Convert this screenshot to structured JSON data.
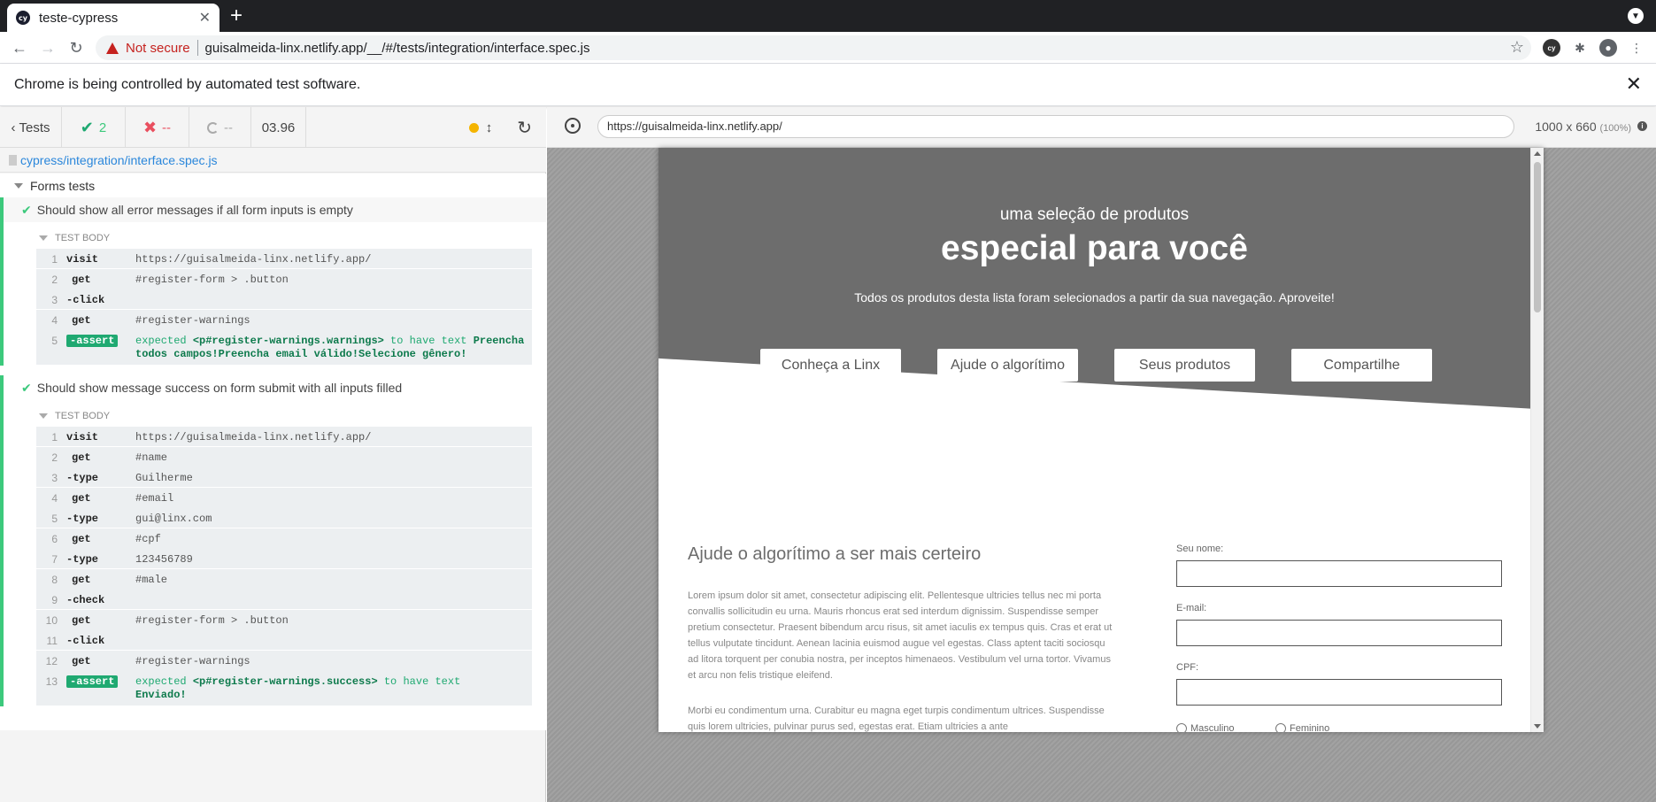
{
  "browser": {
    "tab_title": "teste-cypress",
    "tab_favicon": "cy",
    "new_tab": "+",
    "security": "Not secure",
    "url": "guisalmeida-linx.netlify.app/__/#/tests/integration/interface.spec.js",
    "infobar": "Chrome is being controlled by automated test software."
  },
  "reporter": {
    "tests_label": "Tests",
    "passed": "2",
    "failed": "--",
    "pending": "--",
    "duration": "03.96",
    "spec_path": "cypress/integration/interface.spec.js",
    "suite_title": "Forms tests",
    "tests": [
      {
        "title": "Should show all error messages if all form inputs is empty",
        "body_label": "TEST BODY",
        "commands": [
          {
            "num": "1",
            "name": "visit",
            "msg": "https://guisalmeida-linx.netlify.app/"
          },
          {
            "num": "2",
            "name": "get",
            "msg": "#register-form > .button"
          },
          {
            "num": "3",
            "name": "-click",
            "msg": ""
          },
          {
            "num": "4",
            "name": "get",
            "msg": "#register-warnings"
          },
          {
            "num": "5",
            "name": "-assert",
            "msg_prefix": "expected ",
            "msg_subject": "<p#register-warnings.warnings>",
            "msg_mid": " to have text ",
            "msg_value": "Preencha todos campos!Preencha email válido!Selecione gênero!"
          }
        ]
      },
      {
        "title": "Should show message success on form submit with all inputs filled",
        "body_label": "TEST BODY",
        "commands": [
          {
            "num": "1",
            "name": "visit",
            "msg": "https://guisalmeida-linx.netlify.app/"
          },
          {
            "num": "2",
            "name": "get",
            "msg": "#name"
          },
          {
            "num": "3",
            "name": "-type",
            "msg": "Guilherme"
          },
          {
            "num": "4",
            "name": "get",
            "msg": "#email"
          },
          {
            "num": "5",
            "name": "-type",
            "msg": "gui@linx.com"
          },
          {
            "num": "6",
            "name": "get",
            "msg": "#cpf"
          },
          {
            "num": "7",
            "name": "-type",
            "msg": "123456789"
          },
          {
            "num": "8",
            "name": "get",
            "msg": "#male"
          },
          {
            "num": "9",
            "name": "-check",
            "msg": ""
          },
          {
            "num": "10",
            "name": "get",
            "msg": "#register-form > .button"
          },
          {
            "num": "11",
            "name": "-click",
            "msg": ""
          },
          {
            "num": "12",
            "name": "get",
            "msg": "#register-warnings"
          },
          {
            "num": "13",
            "name": "-assert",
            "msg_prefix": "expected ",
            "msg_subject": "<p#register-warnings.success>",
            "msg_mid": " to have text ",
            "msg_value": "Enviado!"
          }
        ]
      }
    ]
  },
  "aut": {
    "url": "https://guisalmeida-linx.netlify.app/",
    "viewport": "1000 x 660",
    "zoom": "(100%)",
    "hero_sub": "uma seleção de produtos",
    "hero_title": "especial para você",
    "hero_desc": "Todos os produtos desta lista foram selecionados a partir da sua navegação. Aproveite!",
    "buttons": [
      "Conheça a Linx",
      "Ajude o algorítimo",
      "Seus produtos",
      "Compartilhe"
    ],
    "content_title": "Ajude o algorítimo a ser mais certeiro",
    "paragraph1": "Lorem ipsum dolor sit amet, consectetur adipiscing elit. Pellentesque ultricies tellus nec mi porta convallis sollicitudin eu urna. Mauris rhoncus erat sed interdum dignissim. Suspendisse semper pretium consectetur. Praesent bibendum arcu risus, sit amet iaculis ex tempus quis. Cras et erat ut tellus vulputate tincidunt. Aenean lacinia euismod augue vel egestas. Class aptent taciti sociosqu ad litora torquent per conubia nostra, per inceptos himenaeos. Vestibulum vel urna tortor. Vivamus et arcu non felis tristique eleifend.",
    "paragraph2": "Morbi eu condimentum urna. Curabitur eu magna eget turpis condimentum ultrices. Suspendisse quis lorem ultricies, pulvinar purus sed, egestas erat. Etiam ultricies a ante",
    "form": {
      "name_label": "Seu nome:",
      "email_label": "E-mail:",
      "cpf_label": "CPF:",
      "male_label": "Masculino",
      "female_label": "Feminino"
    }
  }
}
